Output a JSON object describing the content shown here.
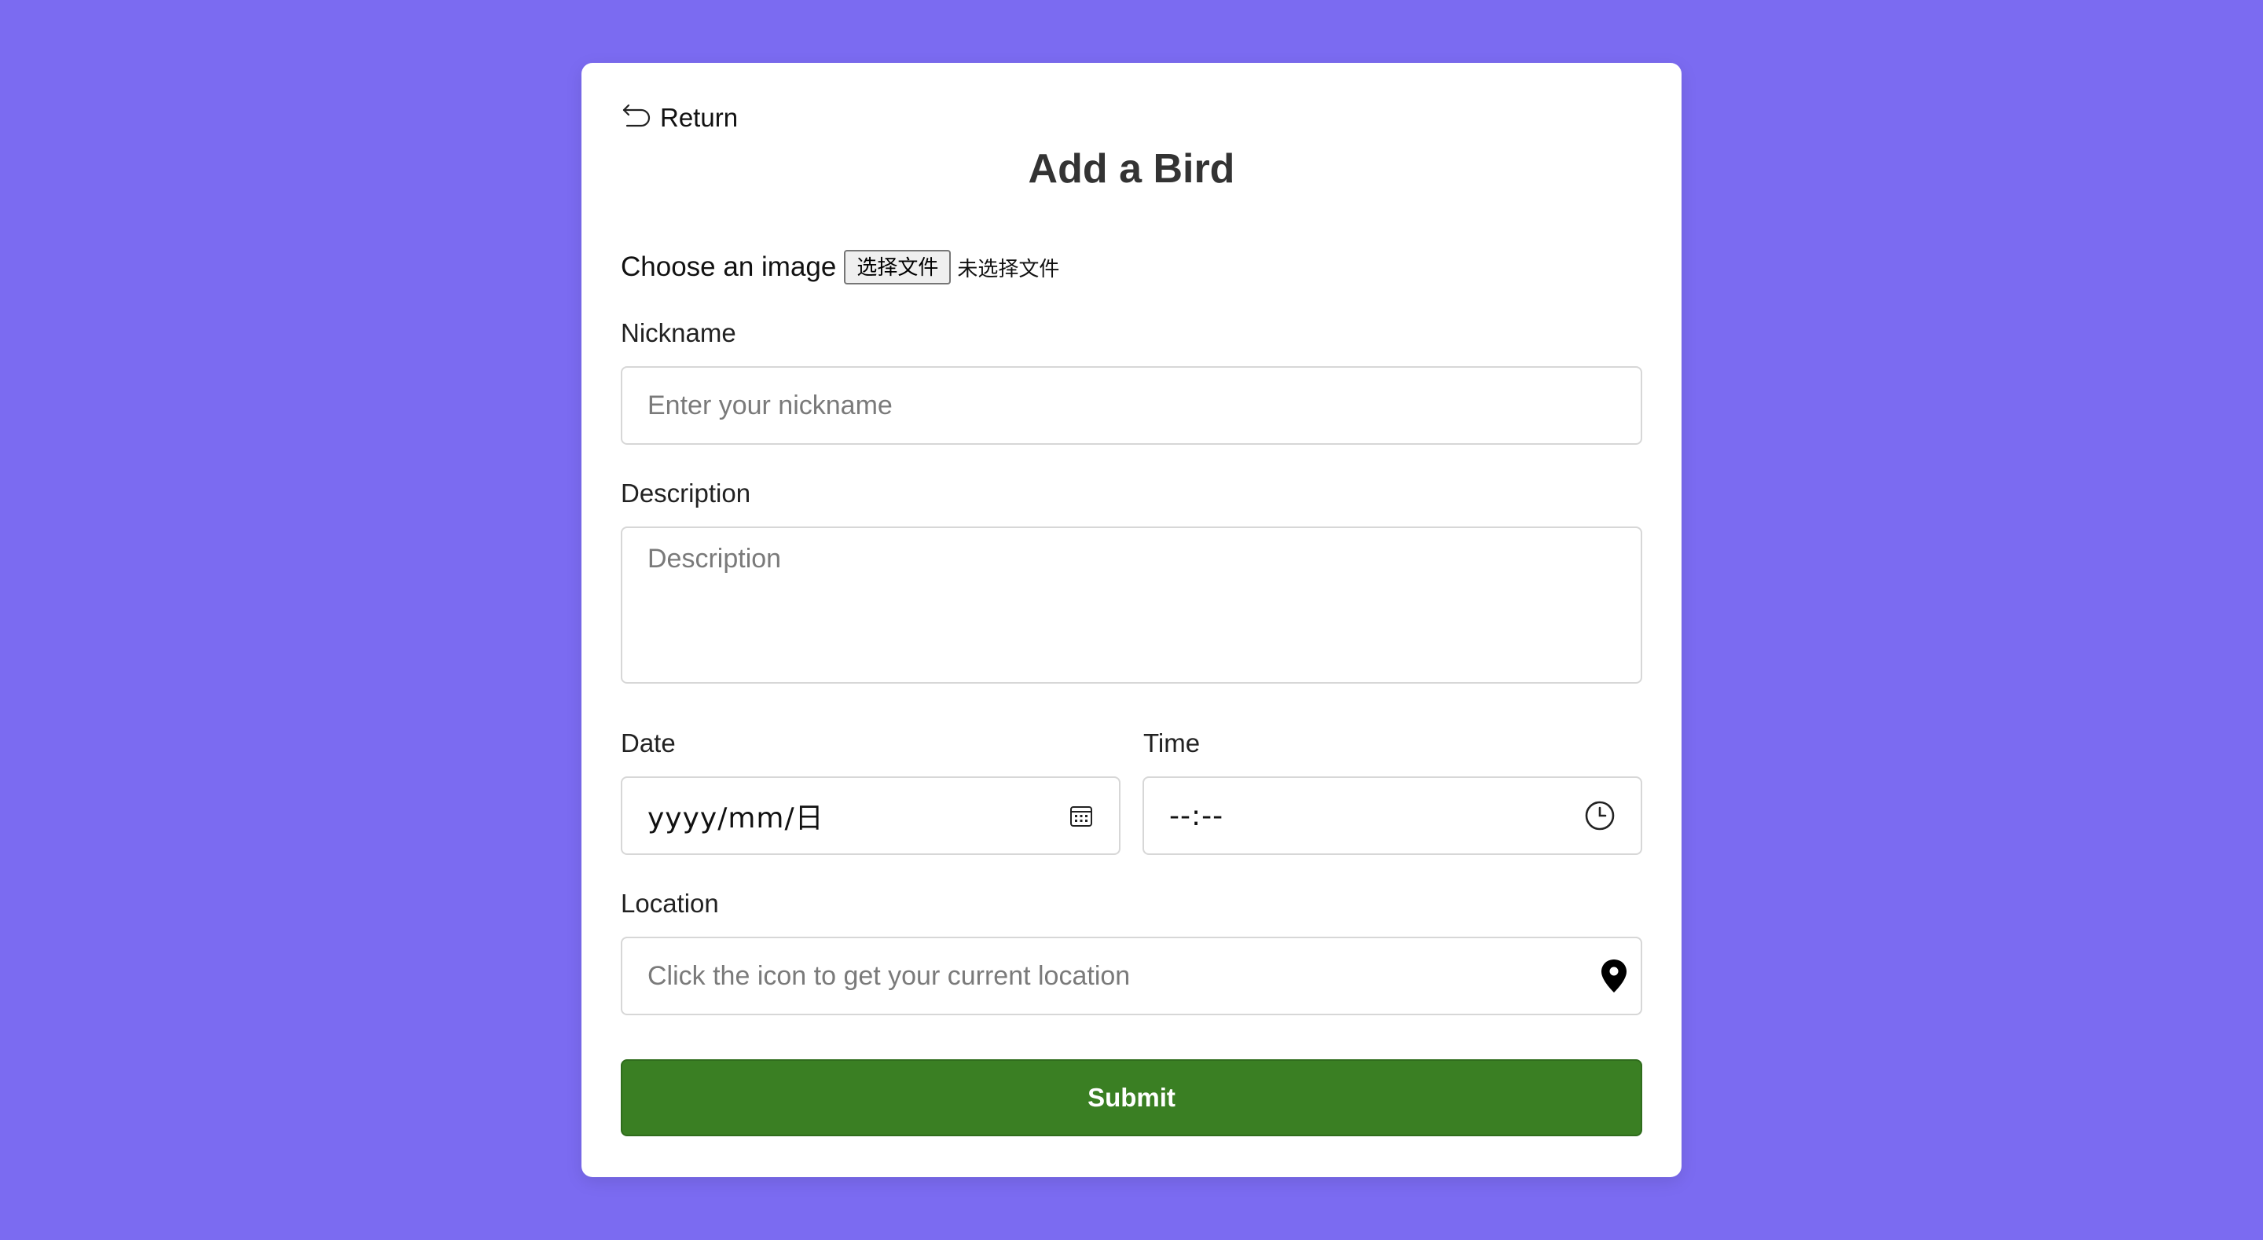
{
  "colors": {
    "page_background": "#7b6bf1",
    "card_background": "#ffffff",
    "submit_background": "#3a7f23",
    "submit_text": "#ffffff"
  },
  "nav": {
    "return_label": "Return",
    "return_icon": "return-arrow-icon"
  },
  "page": {
    "title": "Add a Bird"
  },
  "image_upload": {
    "label": "Choose an image",
    "button_label": "选择文件",
    "status": "未选择文件"
  },
  "nickname": {
    "label": "Nickname",
    "placeholder": "Enter your nickname",
    "value": ""
  },
  "description": {
    "label": "Description",
    "placeholder": "Description",
    "value": ""
  },
  "date": {
    "label": "Date",
    "display": "yyyy/mm/日",
    "icon": "calendar-icon"
  },
  "time": {
    "label": "Time",
    "display": "--:--",
    "icon": "clock-icon"
  },
  "location": {
    "label": "Location",
    "placeholder": "Click the icon to get your current location",
    "value": "",
    "icon": "location-pin-icon"
  },
  "submit": {
    "label": "Submit"
  }
}
